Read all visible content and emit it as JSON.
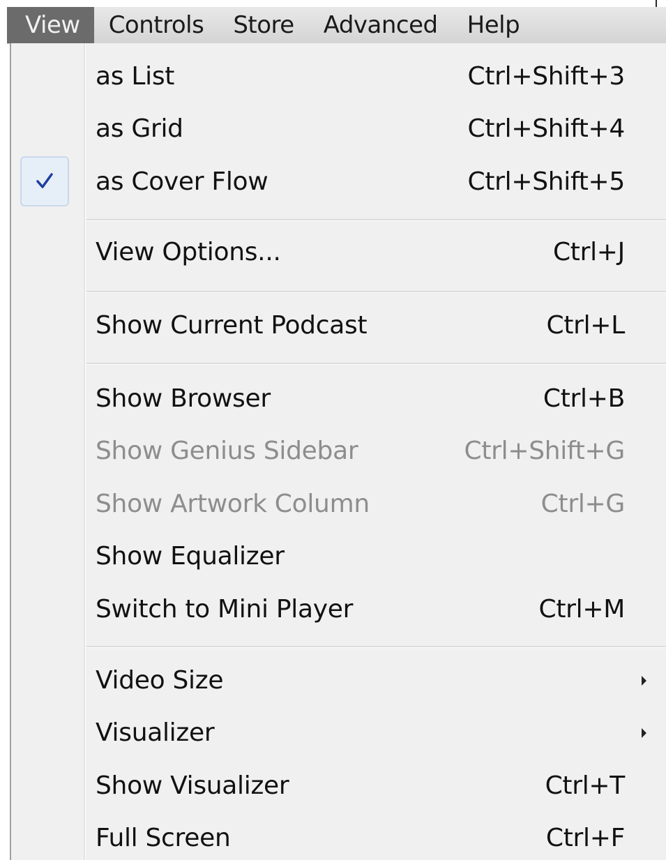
{
  "menubar": {
    "items": [
      {
        "label": "View",
        "active": true
      },
      {
        "label": "Controls",
        "active": false
      },
      {
        "label": "Store",
        "active": false
      },
      {
        "label": "Advanced",
        "active": false
      },
      {
        "label": "Help",
        "active": false
      }
    ]
  },
  "view_menu": {
    "items": [
      {
        "label": "as List",
        "shortcut": "Ctrl+Shift+3",
        "checked": false,
        "enabled": true
      },
      {
        "label": "as Grid",
        "shortcut": "Ctrl+Shift+4",
        "checked": false,
        "enabled": true
      },
      {
        "label": "as Cover Flow",
        "shortcut": "Ctrl+Shift+5",
        "checked": true,
        "enabled": true,
        "check_icon": "checkmark-icon"
      },
      {
        "label": "View Options...",
        "shortcut": "Ctrl+J",
        "enabled": true
      },
      {
        "label": "Show Current Podcast",
        "shortcut": "Ctrl+L",
        "enabled": true
      },
      {
        "label": "Show Browser",
        "shortcut": "Ctrl+B",
        "enabled": true
      },
      {
        "label": "Show Genius Sidebar",
        "shortcut": "Ctrl+Shift+G",
        "enabled": false
      },
      {
        "label": "Show Artwork Column",
        "shortcut": "Ctrl+G",
        "enabled": false
      },
      {
        "label": "Show Equalizer",
        "shortcut": "",
        "enabled": true
      },
      {
        "label": "Switch to Mini Player",
        "shortcut": "Ctrl+M",
        "enabled": true
      },
      {
        "label": "Video Size",
        "shortcut": "",
        "enabled": true,
        "submenu": true,
        "arrow_icon": "submenu-arrow-icon"
      },
      {
        "label": "Visualizer",
        "shortcut": "",
        "enabled": true,
        "submenu": true,
        "arrow_icon": "submenu-arrow-icon"
      },
      {
        "label": "Show Visualizer",
        "shortcut": "Ctrl+T",
        "enabled": true
      },
      {
        "label": "Full Screen",
        "shortcut": "Ctrl+F",
        "enabled": true
      }
    ]
  },
  "colors": {
    "menubar_active_bg": "#6b6b6b",
    "menu_bg": "#f0f0f0",
    "disabled_text": "#8d8d8d",
    "check_color": "#1f3f9e"
  }
}
